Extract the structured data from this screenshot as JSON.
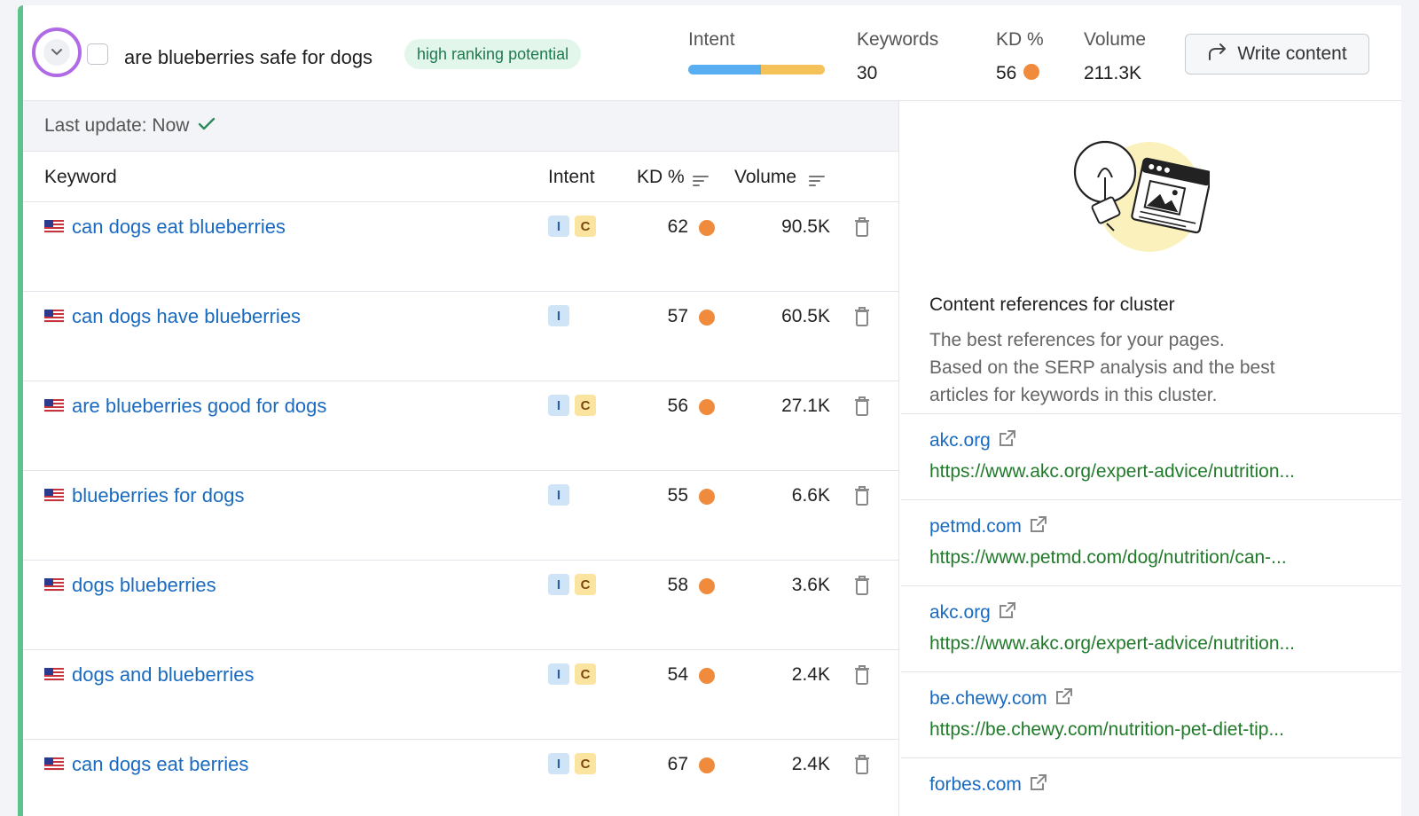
{
  "header": {
    "cluster_name": "are blueberries safe for dogs",
    "badge": "high ranking potential",
    "intent_label": "Intent",
    "keywords_label": "Keywords",
    "keywords_value": "30",
    "kd_label": "KD %",
    "kd_value": "56",
    "volume_label": "Volume",
    "volume_value": "211.3K",
    "write_button": "Write content",
    "intent_bar": [
      {
        "type": "informational",
        "fraction": 0.53,
        "color": "#58aef0"
      },
      {
        "type": "commercial",
        "fraction": 0.47,
        "color": "#f5c259"
      }
    ]
  },
  "table": {
    "last_update": "Last update: Now",
    "columns": {
      "keyword": "Keyword",
      "intent": "Intent",
      "kd": "KD %",
      "volume": "Volume"
    },
    "rows": [
      {
        "keyword": "can dogs eat blueberries",
        "intent": [
          "I",
          "C"
        ],
        "kd": "62",
        "volume": "90.5K"
      },
      {
        "keyword": "can dogs have blueberries",
        "intent": [
          "I"
        ],
        "kd": "57",
        "volume": "60.5K"
      },
      {
        "keyword": "are blueberries good for dogs",
        "intent": [
          "I",
          "C"
        ],
        "kd": "56",
        "volume": "27.1K"
      },
      {
        "keyword": "blueberries for dogs",
        "intent": [
          "I"
        ],
        "kd": "55",
        "volume": "6.6K"
      },
      {
        "keyword": "dogs blueberries",
        "intent": [
          "I",
          "C"
        ],
        "kd": "58",
        "volume": "3.6K"
      },
      {
        "keyword": "dogs and blueberries",
        "intent": [
          "I",
          "C"
        ],
        "kd": "54",
        "volume": "2.4K"
      },
      {
        "keyword": "can dogs eat berries",
        "intent": [
          "I",
          "C"
        ],
        "kd": "67",
        "volume": "2.4K"
      }
    ]
  },
  "references": {
    "title": "Content references for cluster",
    "desc_line1": "The best references for your pages.",
    "desc_line2": "Based on the SERP analysis and the best",
    "desc_line3": "articles for keywords in this cluster.",
    "items": [
      {
        "domain": "akc.org",
        "url": "https://www.akc.org/expert-advice/nutrition..."
      },
      {
        "domain": "petmd.com",
        "url": "https://www.petmd.com/dog/nutrition/can-..."
      },
      {
        "domain": "akc.org",
        "url": "https://www.akc.org/expert-advice/nutrition..."
      },
      {
        "domain": "be.chewy.com",
        "url": "https://be.chewy.com/nutrition-pet-diet-tip..."
      },
      {
        "domain": "forbes.com",
        "url": ""
      }
    ]
  },
  "colors": {
    "accent_green": "#5ec28e",
    "kd_orange": "#f08a3c",
    "link_blue": "#1a6ac0",
    "url_green": "#207a2a"
  }
}
